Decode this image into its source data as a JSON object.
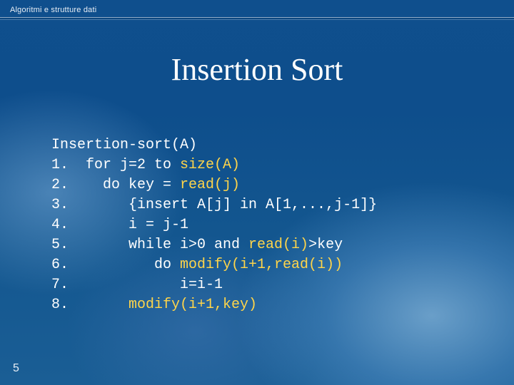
{
  "header": {
    "course": "Algoritmi e strutture dati"
  },
  "title": "Insertion Sort",
  "slide_number": "5",
  "code": {
    "l0": "Insertion-sort(A)",
    "l1a": "1.  for j=2 to ",
    "l1b": "size(A)",
    "l2a": "2.    do key = ",
    "l2b": "read(j)",
    "l3": "3.       {insert A[j] in A[1,...,j-1]}",
    "l4": "4.       i = j-1",
    "l5a": "5.       while i>0 and ",
    "l5b": "read(i)",
    "l5c": ">key",
    "l6a": "6.          do ",
    "l6b": "modify(i+1,read(i))",
    "l7": "7.             i=i-1",
    "l8a": "8.       ",
    "l8b": "modify(i+1,key)"
  }
}
